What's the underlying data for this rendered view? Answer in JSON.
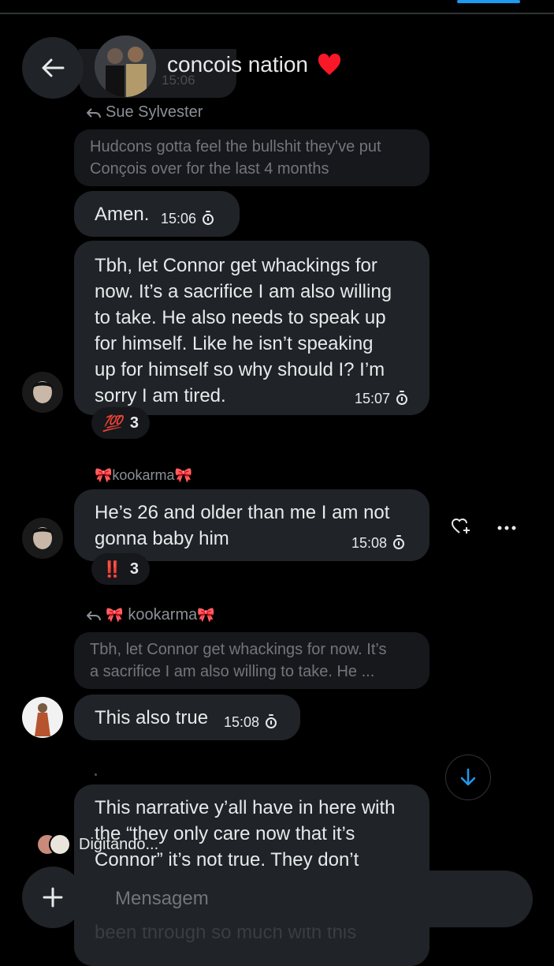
{
  "header": {
    "title": "concois nation",
    "heart": "❤️",
    "ghost_time": "15:06"
  },
  "messages": {
    "m1": {
      "reply_to_name": "Sue Sylvester",
      "quote_line1": "Hudcons gotta feel the bullshit they've put",
      "quote_line2": "Conçois over for the last 4 months",
      "text": "Amen.",
      "time": "15:06"
    },
    "m2": {
      "lines": [
        "Tbh, let Connor get whackings for",
        "now. It’s a sacrifice I am also willing",
        "to take. He also needs to speak up",
        "for himself. Like he isn’t speaking",
        "up for himself so why should I? I’m",
        "sorry I am tired."
      ],
      "time": "15:07",
      "reaction_emoji": "💯",
      "reaction_count": "3"
    },
    "m3": {
      "sender": "kookarma",
      "lines": [
        "He’s 26 and older than me I am not",
        "gonna baby him"
      ],
      "time": "15:08",
      "reaction_emoji": "‼️",
      "reaction_count": "3"
    },
    "m4": {
      "reply_to_name": "kookarma",
      "quote_line1": "Tbh, let Connor get whackings for now. It’s",
      "quote_line2": "a sacrifice I am also willing to take. He ...",
      "text": "This also true",
      "time": "15:08"
    },
    "m5": {
      "lines": [
        "This narrative y’all have in here with",
        "the “they only care now that it’s",
        "Connor” it’s not true. They don’t"
      ],
      "faded_line": "been through so much with this"
    }
  },
  "typing": {
    "label": "Digitando..."
  },
  "composer": {
    "placeholder": "Mensagem"
  },
  "bow": "🎀",
  "colors": {
    "background": "#000000",
    "bubble": "#202327",
    "quote": "#16181c",
    "accent": "#1d9bf0",
    "heart": "#f91828"
  },
  "icons": [
    "back-arrow-icon",
    "timer-icon",
    "reply-arrow-icon",
    "react-heart-plus-icon",
    "more-dots-icon",
    "scroll-down-arrow-icon",
    "plus-icon"
  ]
}
